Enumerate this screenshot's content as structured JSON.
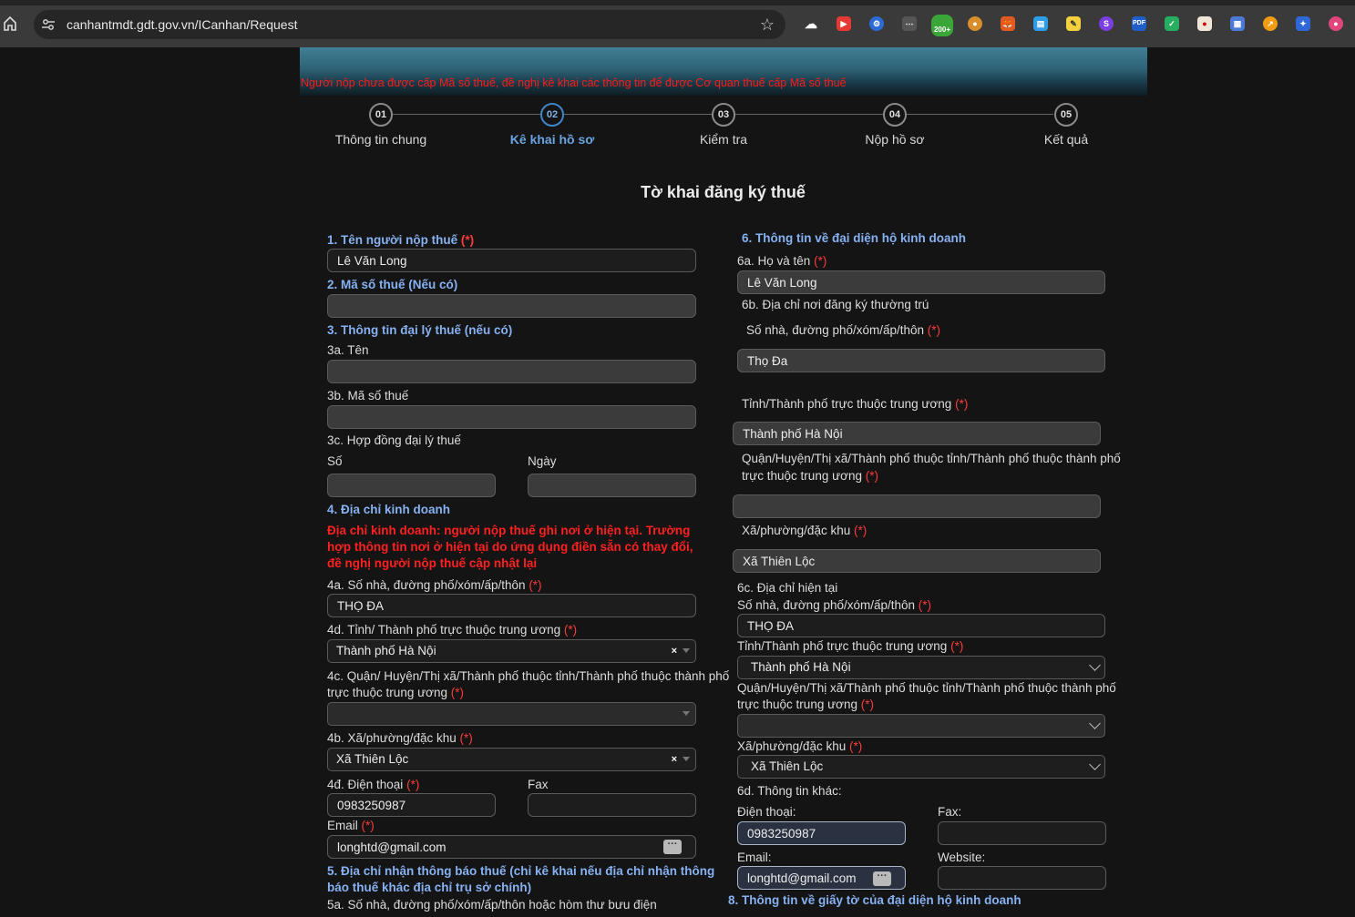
{
  "browser": {
    "url": "canhantmdt.gdt.gov.vn/ICanhan/Request",
    "ext_badge": "200+"
  },
  "banner": {
    "notice": "Người nộp chưa được cấp Mã số thuế, đề nghị kê khai các thông tin để được Cơ quan thuế cấp Mã số thuế"
  },
  "steps": [
    {
      "num": "01",
      "label": "Thông tin chung"
    },
    {
      "num": "02",
      "label": "Kê khai hồ sơ"
    },
    {
      "num": "03",
      "label": "Kiểm tra"
    },
    {
      "num": "04",
      "label": "Nộp hồ sơ"
    },
    {
      "num": "05",
      "label": "Kết quả"
    }
  ],
  "form_title": "Tờ khai đăng ký thuế",
  "req_mark": "(*)",
  "left": {
    "s1": "1. Tên người nộp thuế",
    "s1_value": "Lê Văn Long",
    "s2": "2. Mã số thuế (Nếu có)",
    "s2_value": "",
    "s3": "3. Thông tin đại lý thuế (nếu có)",
    "s3a": "3a. Tên",
    "s3b": "3b. Mã số thuế",
    "s3c": "3c. Hợp đồng đại lý thuế",
    "so": "Số",
    "ngay": "Ngày",
    "s4": "4. Địa chỉ kinh doanh",
    "s4_note": "Địa chỉ kinh doanh: người nộp thuế ghi nơi ở hiện tại. Trường hợp thông tin nơi ở hiện tại do ứng dụng điền sẵn có thay đổi, đề nghị người nộp thuế cập nhật lại",
    "s4a": "4a. Số nhà, đường phố/xóm/ấp/thôn",
    "s4a_value": "THỌ ĐA",
    "s4d": "4d. Tỉnh/ Thành phố trực thuộc trung ương",
    "s4d_value": "Thành phố Hà Nội",
    "s4c_line1": "4c. Quận/ Huyện/Thị xã/Thành phố thuộc tỉnh/Thành phố thuộc thành phố",
    "s4c_line2": "trực thuộc trung ương",
    "s4c_value": "",
    "s4b": "4b. Xã/phường/đặc khu",
    "s4b_value": "Xã Thiên Lộc",
    "s4dd": "4đ. Điện thoại",
    "s4dd_value": "0983250987",
    "fax": "Fax",
    "fax_value": "",
    "email": "Email",
    "email_value": "longhtd@gmail.com",
    "s5_line1": "5. Địa chỉ nhận thông báo thuế (chỉ kê khai nếu địa chỉ nhận thông",
    "s5_line2": "báo thuế khác địa chỉ trụ sở chính)",
    "s5a": "5a. Số nhà, đường phố/xóm/ấp/thôn hoặc hòm thư bưu điện"
  },
  "right": {
    "s6": "6. Thông tin về đại diện hộ kinh doanh",
    "s6a": "6a. Họ và tên",
    "s6a_value": "Lê Văn Long",
    "s6b": "6b. Địa chỉ nơi đăng ký thường trú",
    "street": "Số nhà, đường phố/xóm/ấp/thôn",
    "street_value": "Thọ Đa",
    "province": "Tỉnh/Thành phố trực thuộc trung ương",
    "province_value": "Thành phố Hà Nội",
    "district_line1": "Quận/Huyện/Thị xã/Thành phố thuộc tỉnh/Thành phố thuộc thành phố",
    "district_line2": "trực thuộc trung ương",
    "district_value": "",
    "ward": "Xã/phường/đặc khu",
    "ward_value": "Xã Thiên Lộc",
    "s6c": "6c. Địa chỉ hiện tại",
    "c_street": "Số nhà, đường phố/xóm/ấp/thôn",
    "c_street_value": "THỌ ĐA",
    "c_province": "Tỉnh/Thành phố trực thuộc trung ương",
    "c_province_value": "Thành phố Hà Nội",
    "c_district_line1": "Quận/Huyện/Thị xã/Thành phố thuộc tỉnh/Thành phố thuộc thành phố",
    "c_district_line2": "trực thuộc trung ương",
    "c_district_value": "",
    "c_ward": "Xã/phường/đặc khu",
    "c_ward_value": "Xã Thiên Lộc",
    "s6d": "6d. Thông tin khác:",
    "phone": "Điện thoại:",
    "phone_value": "0983250987",
    "fax": "Fax:",
    "fax_value": "",
    "email": "Email:",
    "email_value": "longhtd@gmail.com",
    "website": "Website:",
    "website_value": "",
    "s8": "8. Thông tin về giấy tờ của đại diện hộ kinh doanh"
  },
  "colors": {
    "section": "#86b1f2",
    "required": "#ff3b3b",
    "active_step": "#3e86c8",
    "background": "#141414"
  }
}
